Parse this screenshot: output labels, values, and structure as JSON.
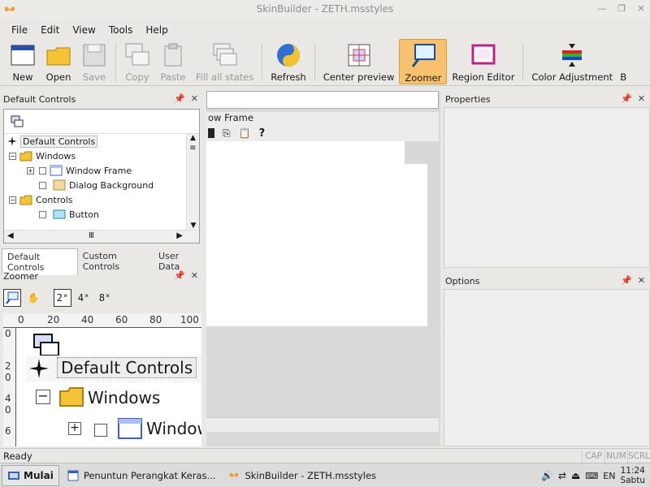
{
  "window": {
    "title": "SkinBuilder - ZETH.msstyles"
  },
  "menu": [
    {
      "label": "File"
    },
    {
      "label": "Edit"
    },
    {
      "label": "View"
    },
    {
      "label": "Tools"
    },
    {
      "label": "Help"
    }
  ],
  "toolbar": [
    {
      "label": "New"
    },
    {
      "label": "Open"
    },
    {
      "label": "Save"
    },
    {
      "label": "Copy"
    },
    {
      "label": "Paste"
    },
    {
      "label": "Fill all states"
    },
    {
      "label": "Refresh"
    },
    {
      "label": "Center preview"
    },
    {
      "label": "Zoomer"
    },
    {
      "label": "Region Editor"
    },
    {
      "label": "Color Adjustment"
    },
    {
      "label": "B"
    }
  ],
  "default_controls_panel": {
    "title": "Default Controls",
    "tree": [
      {
        "label": "Default Controls"
      },
      {
        "label": "Windows"
      },
      {
        "label": "Window Frame"
      },
      {
        "label": "Dialog Background"
      },
      {
        "label": "Controls"
      },
      {
        "label": "Button"
      }
    ],
    "tabs": [
      {
        "label": "Default Controls"
      },
      {
        "label": "Custom Controls"
      },
      {
        "label": "User Data"
      }
    ]
  },
  "zoomer_panel": {
    "title": "Zoomer",
    "zoom_levels": [
      "2",
      "4",
      "8"
    ],
    "ruler_h": [
      "0",
      "20",
      "40",
      "60",
      "80",
      "100"
    ],
    "ruler_v": [
      "0",
      "2",
      "0",
      "4",
      "0",
      "6"
    ],
    "preview_labels": [
      "Default Controls",
      "Windows",
      "Window"
    ]
  },
  "center": {
    "doc_header": "ow Frame"
  },
  "properties_panel": {
    "title": "Properties"
  },
  "options_panel": {
    "title": "Options"
  },
  "status": {
    "text": "Ready",
    "indicators": [
      "CAP",
      "NUM",
      "SCRL"
    ]
  },
  "taskbar": {
    "start_label": "Mulai",
    "tasks": [
      {
        "label": "Penuntun Perangkat Keras..."
      },
      {
        "label": "SkinBuilder - ZETH.msstyles"
      }
    ],
    "lang": "EN",
    "time": "11:24",
    "day": "Sabtu"
  },
  "colors": {
    "accent_active": "#f7c16d"
  }
}
